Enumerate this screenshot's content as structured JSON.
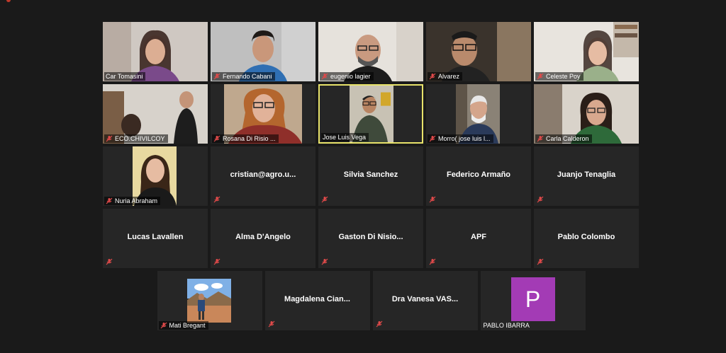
{
  "participants": [
    {
      "name": "Car Tomasini",
      "muted": false,
      "video": true
    },
    {
      "name": "Fernando Cabani",
      "muted": true,
      "video": true
    },
    {
      "name": "eugenio lagier",
      "muted": true,
      "video": true
    },
    {
      "name": "Alvarez",
      "muted": true,
      "video": true
    },
    {
      "name": "Celeste Poy",
      "muted": true,
      "video": true
    },
    {
      "name": "ECO.CHIVILCOY",
      "muted": true,
      "video": true
    },
    {
      "name": "Rosana Di Risio ...",
      "muted": true,
      "video": true
    },
    {
      "name": "Jose Luis Vega",
      "muted": false,
      "video": true,
      "speaking": true
    },
    {
      "name": "Morro( jose luis l...",
      "muted": true,
      "video": true
    },
    {
      "name": "Carla Calderon",
      "muted": true,
      "video": true
    },
    {
      "name": "Nuria Abraham",
      "muted": true,
      "video": true
    },
    {
      "name": "cristian@agro.u...",
      "muted": true,
      "video": false
    },
    {
      "name": "Silvia Sanchez",
      "muted": true,
      "video": false
    },
    {
      "name": "Federico Armaño",
      "muted": true,
      "video": false
    },
    {
      "name": "Juanjo Tenaglia",
      "muted": true,
      "video": false
    },
    {
      "name": "Lucas Lavallen",
      "muted": true,
      "video": false
    },
    {
      "name": "Alma D'Angelo",
      "muted": true,
      "video": false
    },
    {
      "name": "Gaston Di Nisio...",
      "muted": true,
      "video": false
    },
    {
      "name": "APF",
      "muted": true,
      "video": false
    },
    {
      "name": "Pablo Colombo",
      "muted": true,
      "video": false
    },
    {
      "name": "Mati Bregant",
      "muted": true,
      "video": true
    },
    {
      "name": "Magdalena Cian...",
      "muted": true,
      "video": false
    },
    {
      "name": "Dra Vanesa VAS...",
      "muted": true,
      "video": false
    },
    {
      "name": "PABLO IBARRA",
      "muted": false,
      "video": false,
      "avatar_letter": "P",
      "avatar_color": "#a33bb5"
    }
  ],
  "colors": {
    "background": "#1a1a1a",
    "tile": "#262626",
    "speaking_border": "#e8e36a",
    "mute_red": "#c0392b"
  }
}
